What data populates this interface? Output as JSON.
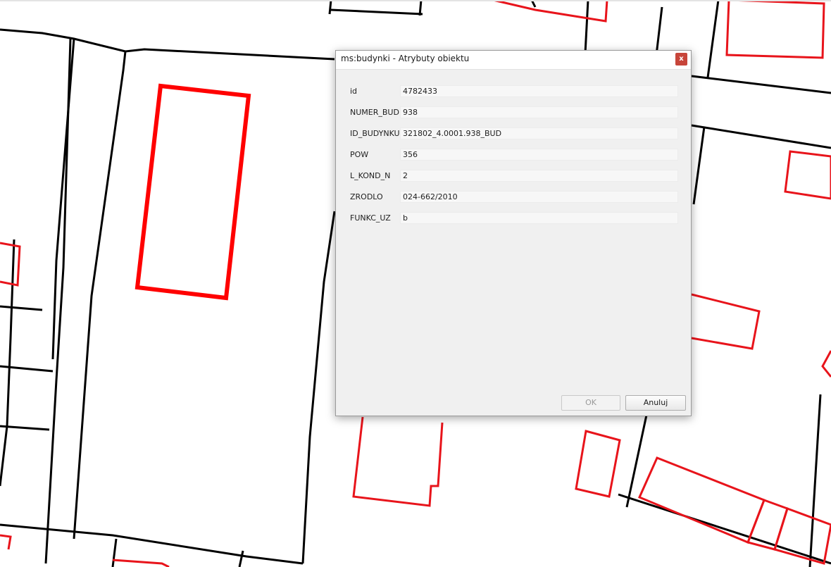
{
  "dialog": {
    "title": "ms:budynki - Atrybuty obiektu",
    "close_icon": "close-icon",
    "close_glyph": "x",
    "attributes": [
      {
        "label": "id",
        "value": "4782433"
      },
      {
        "label": "NUMER_BUD",
        "value": "938"
      },
      {
        "label": "ID_BUDYNKU",
        "value": "321802_4.0001.938_BUD"
      },
      {
        "label": "POW",
        "value": "356"
      },
      {
        "label": "L_KOND_N",
        "value": "2"
      },
      {
        "label": "ZRODLO",
        "value": "024-662/2010"
      },
      {
        "label": "FUNKC_UZ",
        "value": "b"
      }
    ],
    "ok_label": "OK",
    "ok_enabled": false,
    "cancel_label": "Anuluj"
  },
  "colors": {
    "parcel_outline": "#000000",
    "building_outline": "#e8141b",
    "selected_building": "#ff0000",
    "close_button": "#c7453a"
  }
}
